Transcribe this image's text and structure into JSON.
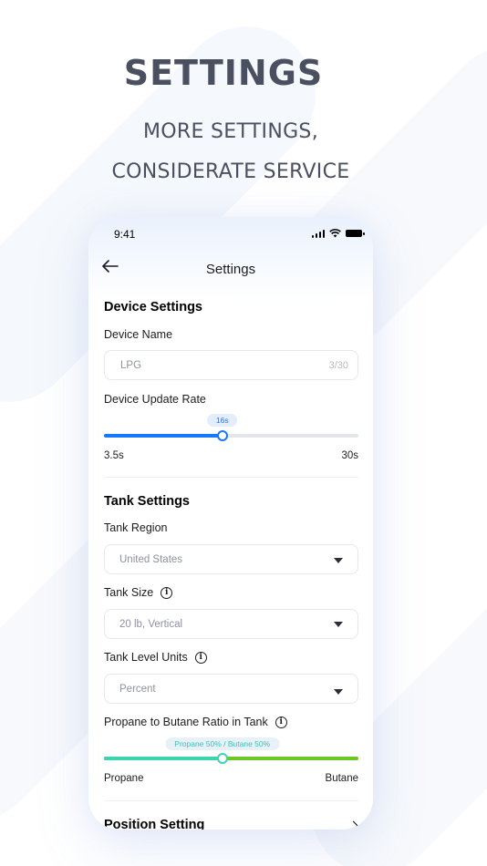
{
  "hero": {
    "title": "SETTINGS",
    "subtitle_line1": "MORE SETTINGS,",
    "subtitle_line2": "CONSIDERATE SERVICE"
  },
  "status_bar": {
    "time": "9:41"
  },
  "nav": {
    "title": "Settings"
  },
  "device_settings": {
    "title": "Device Settings",
    "name_label": "Device Name",
    "name_value": "LPG",
    "name_counter": "3/30",
    "update_rate_label": "Device Update Rate",
    "update_rate_value_label": "16s",
    "update_rate_fraction": 0.465,
    "update_rate_min": "3.5s",
    "update_rate_max": "30s",
    "accent_color": "#1677ff"
  },
  "tank_settings": {
    "title": "Tank Settings",
    "region_label": "Tank Region",
    "region_value": "United States",
    "size_label": "Tank Size",
    "size_value": "20 lb, Vertical",
    "level_units_label": "Tank Level Units",
    "level_units_value": "Percent",
    "ratio_label": "Propane to Butane Ratio in Tank",
    "ratio_value_label": "Propane 50% / Butane 50%",
    "ratio_fraction": 0.465,
    "ratio_min": "Propane",
    "ratio_max": "Butane",
    "propane_color": "#3fd4b0",
    "butane_color": "#6cc724"
  },
  "position_setting": {
    "title": "Position Setting"
  },
  "icons": {
    "back": "arrow-left-icon",
    "info": "info-icon",
    "dropdown": "caret-down-icon",
    "signal": "cellular-signal-icon",
    "wifi": "wifi-icon",
    "battery": "battery-icon",
    "chevron": "chevron-right-icon"
  }
}
